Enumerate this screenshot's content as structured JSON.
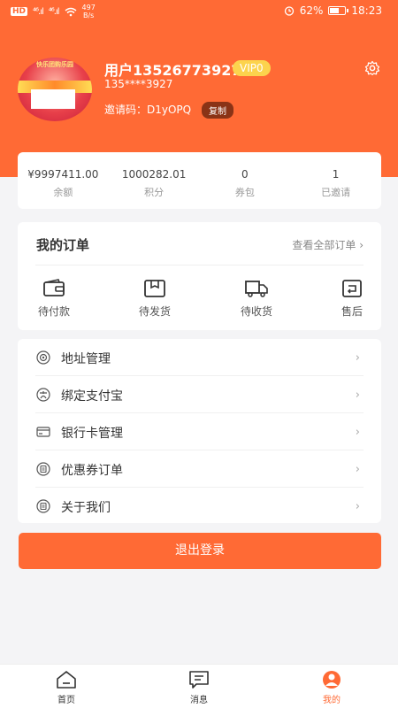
{
  "status_bar": {
    "hd": "HD",
    "signal1": "⁴⁶.ıl",
    "signal2": "⁴⁶.ıl",
    "speed_value": "497",
    "speed_unit": "B/s",
    "battery": "62%",
    "battery_level": 0.62,
    "time": "18:23"
  },
  "profile": {
    "avatar_banner": "快乐团购乐园",
    "username": "用户13526773927",
    "vip": "VIP0",
    "phone": "135****3927",
    "invite_code": "邀请码：D1yOPQ",
    "copy_label": "复制"
  },
  "stats": [
    {
      "value": "¥9997411.00",
      "label": "余额"
    },
    {
      "value": "1000282.01",
      "label": "积分"
    },
    {
      "value": "0",
      "label": "券包"
    },
    {
      "value": "1",
      "label": "已邀请"
    }
  ],
  "orders": {
    "title": "我的订单",
    "view_all": "查看全部订单 ›",
    "tiles": [
      {
        "label": "待付款",
        "icon": "wallet-icon"
      },
      {
        "label": "待发货",
        "icon": "package-icon"
      },
      {
        "label": "待收货",
        "icon": "truck-icon"
      },
      {
        "label": "售后",
        "icon": "return-icon"
      }
    ]
  },
  "menu": [
    {
      "label": "地址管理",
      "icon": "location-icon"
    },
    {
      "label": "绑定支付宝",
      "icon": "alipay-icon"
    },
    {
      "label": "银行卡管理",
      "icon": "bank-card-icon"
    },
    {
      "label": "优惠券订单",
      "icon": "coupon-icon"
    },
    {
      "label": "关于我们",
      "icon": "info-icon"
    }
  ],
  "logout_label": "退出登录",
  "nav": [
    {
      "label": "首页",
      "icon": "home-icon"
    },
    {
      "label": "消息",
      "icon": "message-icon"
    },
    {
      "label": "我的",
      "icon": "user-icon"
    }
  ],
  "colors": {
    "accent": "#ff6a35",
    "vip": "#fcd34d",
    "copy_bg": "#8a3316"
  }
}
